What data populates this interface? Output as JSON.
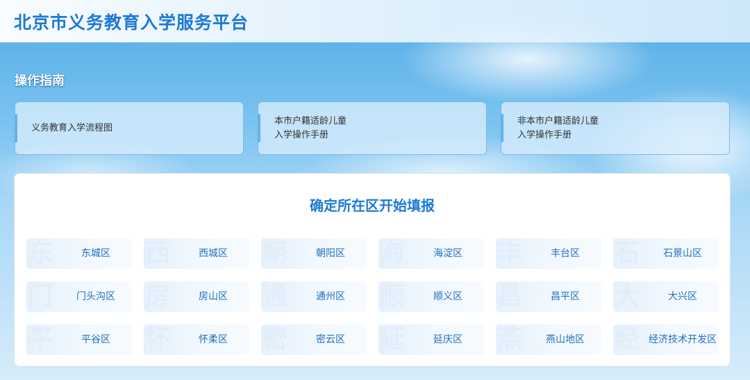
{
  "header": {
    "title": "北京市义务教育入学服务平台"
  },
  "guide": {
    "title": "操作指南",
    "cards": [
      {
        "label": "义务教育入学流程图"
      },
      {
        "label": "本市户籍适龄儿童\n入学操作手册"
      },
      {
        "label": "非本市户籍适龄儿童\n入学操作手册"
      }
    ]
  },
  "districts": {
    "title": "确定所在区开始填报",
    "items": [
      {
        "label": "东城区",
        "watermark": "东"
      },
      {
        "label": "西城区",
        "watermark": "西"
      },
      {
        "label": "朝阳区",
        "watermark": "朝"
      },
      {
        "label": "海淀区",
        "watermark": "海"
      },
      {
        "label": "丰台区",
        "watermark": "丰"
      },
      {
        "label": "石景山区",
        "watermark": "石"
      },
      {
        "label": "门头沟区",
        "watermark": "门"
      },
      {
        "label": "房山区",
        "watermark": "房"
      },
      {
        "label": "通州区",
        "watermark": "通"
      },
      {
        "label": "顺义区",
        "watermark": "顺"
      },
      {
        "label": "昌平区",
        "watermark": "昌"
      },
      {
        "label": "大兴区",
        "watermark": "大"
      },
      {
        "label": "平谷区",
        "watermark": "平"
      },
      {
        "label": "怀柔区",
        "watermark": "怀"
      },
      {
        "label": "密云区",
        "watermark": "密"
      },
      {
        "label": "延庆区",
        "watermark": "延"
      },
      {
        "label": "燕山地区",
        "watermark": "燕"
      },
      {
        "label": "经济技术开发区",
        "watermark": "经"
      }
    ]
  },
  "colors": {
    "brand": "#1d79d5",
    "district_text": "#1d6fbe",
    "card_border": "#78b8ec"
  }
}
